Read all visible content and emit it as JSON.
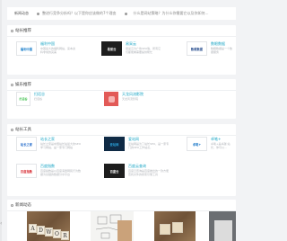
{
  "ticker": {
    "label": "新闻动态",
    "items": [
      "整进行竞争分析吗？以下是你应该做的7个理由",
      "什么是网站策略？为什么你需要它以及你如何…"
    ]
  },
  "sections": [
    {
      "title": "站长推荐",
      "cards": [
        {
          "name": "福利中国",
          "desc": "中国最大的福利网站，来本资料非常的完美",
          "logo": "福利中国",
          "logo_color": "#0f78c8",
          "logo_bg": "#ffffff"
        },
        {
          "name": "易采云",
          "desc": "易采云为广告SEO等，所有它们都能看需要提供帮忙",
          "logo": "易采云",
          "logo_color": "#ffffff",
          "logo_bg": "#1d1d1d"
        },
        {
          "name": "数眼数据",
          "desc": "数眼数据是一个数据服务",
          "logo": "数眼数据",
          "logo_color": "#2a4f8f",
          "logo_bg": "#ffffff"
        }
      ]
    },
    {
      "title": "娱乐推荐",
      "cards": [
        {
          "name": "扫话谷",
          "desc": "扫话谷",
          "logo": "扫话谷",
          "logo_color": "#3cbf4a",
          "logo_bg": "#ffffff"
        },
        {
          "name": "天龙风流影院",
          "desc": "天龙风流影院",
          "logo": "",
          "logo_color": "#ffffff",
          "logo_bg": "#e25a57"
        }
      ]
    },
    {
      "title": "站长工具",
      "cards": [
        {
          "name": "站长之家",
          "desc": "站长之家是中国站长站最大的SEO学习网站，是一家专门网站",
          "logo": "站长之家",
          "logo_color": "#1b66c9",
          "logo_bg": "#ffffff"
        },
        {
          "name": "爱站网",
          "desc": "爱站网是为了站长SEO，是一家专门的SEO工作站点，",
          "logo": "爱站网",
          "logo_color": "#2aa0d8",
          "logo_bg": "#0f2a45"
        },
        {
          "name": "卓笔+",
          "desc": "卓笔+是卓越 站长，你可以…",
          "logo": "卓笔+",
          "logo_color": "#1a78c8",
          "logo_bg": "#ffffff"
        },
        {
          "name": "百度指数",
          "desc": "百度指数是以百度海量网民行为数据为基础的数据分享平台",
          "logo": "百度指数",
          "logo_color": "#d6262d",
          "logo_bg": "#ffffff"
        },
        {
          "name": "百度云查询",
          "desc": "百度云查询是百度推出的一款方便查找文件的搜索引擎工具",
          "logo": "百度云",
          "logo_color": "#ffffff",
          "logo_bg": "#1d1d1d"
        }
      ]
    },
    {
      "title": "新闻动态",
      "images": [
        {
          "letters": [
            "A",
            "D",
            "W",
            "O",
            "R",
            "D",
            "S"
          ]
        },
        {
          "letters": []
        },
        {
          "letters": []
        },
        {
          "letters": []
        }
      ]
    }
  ]
}
